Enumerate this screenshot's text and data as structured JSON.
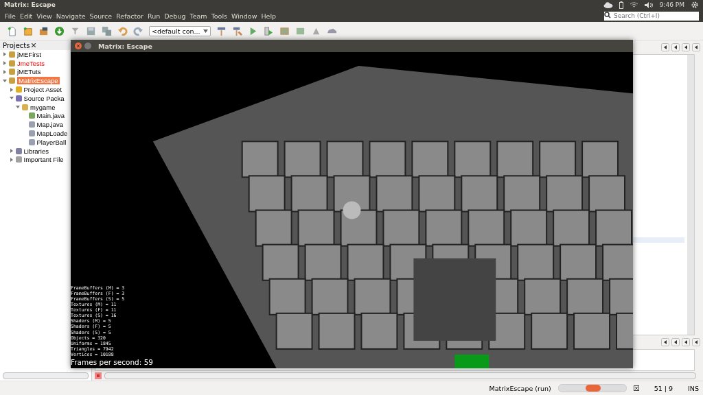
{
  "top_panel": {
    "title": "Matrix: Escape",
    "clock": "9:46 PM"
  },
  "menu": [
    "File",
    "Edit",
    "View",
    "Navigate",
    "Source",
    "Refactor",
    "Run",
    "Debug",
    "Team",
    "Tools",
    "Window",
    "Help"
  ],
  "search": {
    "placeholder": "Search (Ctrl+I)"
  },
  "toolbar": {
    "config": "<default con..."
  },
  "projects_panel": {
    "tab": "Projects",
    "tree": [
      {
        "label": "jMEFirst",
        "kind": "project",
        "expanded": false,
        "selected": false,
        "error": false
      },
      {
        "label": "JmeTests",
        "kind": "project",
        "expanded": false,
        "selected": false,
        "error": true
      },
      {
        "label": "jMETuts",
        "kind": "project",
        "expanded": false,
        "selected": false,
        "error": false
      },
      {
        "label": "MatrixEscape",
        "kind": "project",
        "expanded": true,
        "selected": true,
        "error": false,
        "children": [
          {
            "label": "Project Asset",
            "kind": "assets",
            "expanded": false,
            "selected": false,
            "error": false
          },
          {
            "label": "Source Packa",
            "kind": "sources",
            "expanded": true,
            "selected": false,
            "error": false,
            "children": [
              {
                "label": "mygame",
                "kind": "package",
                "expanded": true,
                "selected": false,
                "error": false,
                "children": [
                  {
                    "label": "Main.java",
                    "kind": "main",
                    "selected": false,
                    "error": false
                  },
                  {
                    "label": "Map.java",
                    "kind": "java",
                    "selected": false,
                    "error": false
                  },
                  {
                    "label": "MapLoade",
                    "kind": "java",
                    "selected": false,
                    "error": false
                  },
                  {
                    "label": "PlayerBall",
                    "kind": "java",
                    "selected": false,
                    "error": false
                  }
                ]
              }
            ]
          },
          {
            "label": "Libraries",
            "kind": "libraries",
            "expanded": false,
            "selected": false,
            "error": false
          },
          {
            "label": "Important File",
            "kind": "files",
            "expanded": false,
            "selected": false,
            "error": false
          }
        ]
      }
    ]
  },
  "game_window": {
    "title": "Matrix: Escape",
    "stats": [
      "FrameBuffers (M) = 3",
      "FrameBuffers (F) = 3",
      "FrameBuffers (S) = 5",
      "Textures (M) = 11",
      "Textures (F) = 11",
      "Textures (S) = 16",
      "Shaders (M) = 5",
      "Shaders (F) = 5",
      "Shaders (S) = 5",
      "Objects = 320",
      "Uniforms = 1845",
      "Triangles = 7942",
      "Vertices = 10188"
    ],
    "fps": "Frames per second: 59"
  },
  "status_bar": {
    "task": "MatrixEscape (run)",
    "position": "51 | 9",
    "mode": "INS"
  }
}
